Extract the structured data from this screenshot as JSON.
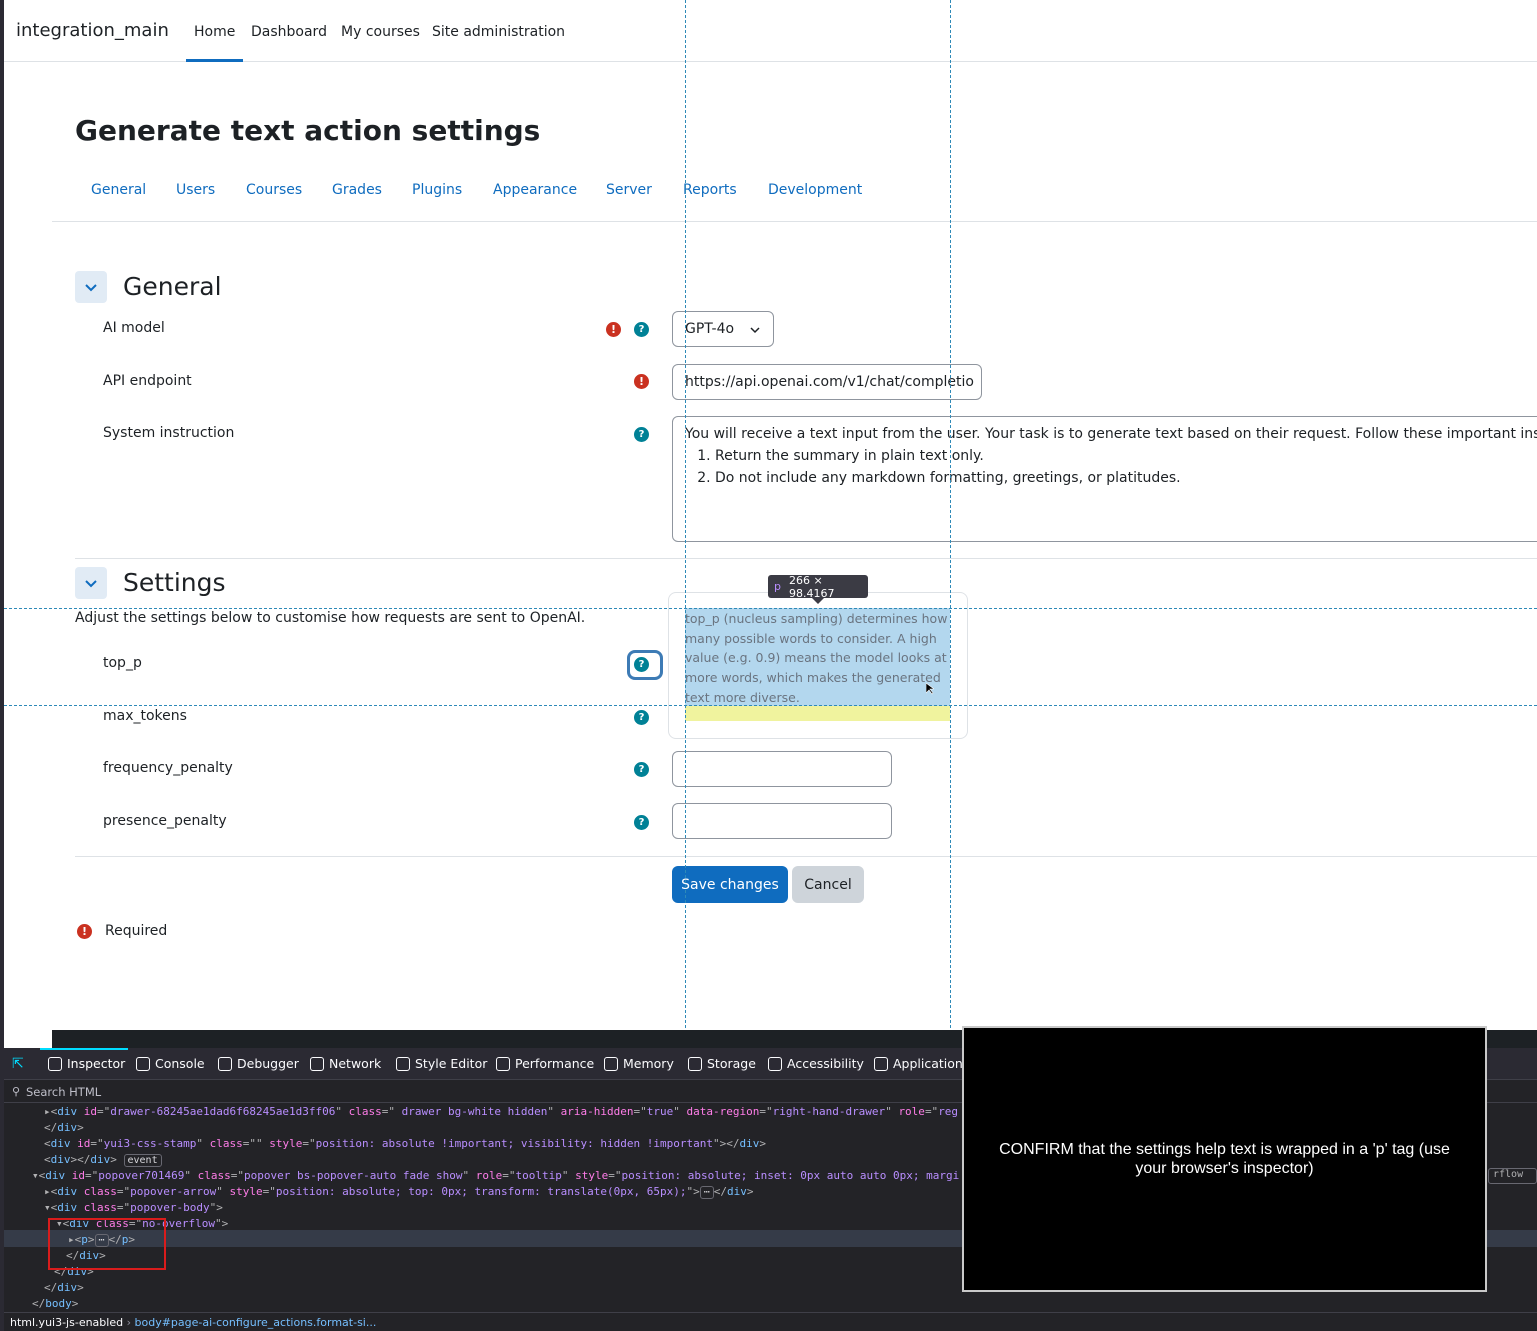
{
  "navbar": {
    "brand": "integration_main",
    "links": [
      "Home",
      "Dashboard",
      "My courses",
      "Site administration"
    ]
  },
  "page": {
    "title": "Generate text action settings",
    "tabs": [
      "General",
      "Users",
      "Courses",
      "Grades",
      "Plugins",
      "Appearance",
      "Server",
      "Reports",
      "Development"
    ]
  },
  "general": {
    "heading": "General",
    "ai_model_label": "AI model",
    "ai_model_value": "GPT-4o",
    "api_endpoint_label": "API endpoint",
    "api_endpoint_value": "https://api.openai.com/v1/chat/completio",
    "system_instruction_label": "System instruction",
    "system_instruction_line1": "You will receive a text input from the user. Your task is to generate text based on their request. Follow these important instruc",
    "system_instruction_item1": "Return the summary in plain text only.",
    "system_instruction_item2": "Do not include any markdown formatting, greetings, or platitudes."
  },
  "settings": {
    "heading": "Settings",
    "description": "Adjust the settings below to customise how requests are sent to OpenAI.",
    "top_p_label": "top_p",
    "max_tokens_label": "max_tokens",
    "frequency_penalty_label": "frequency_penalty",
    "presence_penalty_label": "presence_penalty"
  },
  "popover": {
    "text_lines": [
      "top_p (nucleus sampling) determines how",
      "many possible words to consider. A high",
      "value (e.g. 0.9) means the model looks at",
      "more words, which makes the generated",
      "text more diverse."
    ],
    "dim_tag": "p",
    "dim_size": "266 × 98.4167"
  },
  "buttons": {
    "save": "Save changes",
    "cancel": "Cancel"
  },
  "required_note": "Required",
  "devtools": {
    "tabs": [
      "Inspector",
      "Console",
      "Debugger",
      "Network",
      "Style Editor",
      "Performance",
      "Memory",
      "Storage",
      "Accessibility",
      "Application"
    ],
    "search_placeholder": "Search HTML",
    "lines": [
      {
        "tag": "div",
        "attrs": [
          [
            "id",
            "drawer-68245ae1dad6f68245ae1d3ff06"
          ],
          [
            "class",
            " drawer bg-white hidden"
          ],
          [
            "aria-hidden",
            "true"
          ],
          [
            "data-region",
            "right-hand-drawer"
          ],
          [
            "role",
            "reg"
          ]
        ]
      },
      {
        "text": "</div>"
      },
      {
        "tag": "div",
        "attrs": [
          [
            "id",
            "yui3-css-stamp"
          ],
          [
            "class",
            ""
          ],
          [
            "style",
            "position: absolute !important; visibility: hidden !important"
          ]
        ],
        "close": "</div>"
      },
      {
        "text": "<div></div>",
        "badge": "event"
      },
      {
        "tag": "div",
        "attrs": [
          [
            "id",
            "popover701469"
          ],
          [
            "class",
            "popover bs-popover-auto fade show"
          ],
          [
            "role",
            "tooltip"
          ],
          [
            "style",
            "position: absolute; inset: 0px auto auto 0px; margi"
          ]
        ]
      },
      {
        "tag": "div",
        "attrs": [
          [
            "class",
            "popover-arrow"
          ],
          [
            "style",
            "position: absolute; top: 0px; transform: translate(0px, 65px);"
          ]
        ],
        "close": "</div>"
      },
      {
        "tag": "div",
        "attrs": [
          [
            "class",
            "popover-body"
          ]
        ]
      },
      {
        "tag": "div",
        "attrs": [
          [
            "class",
            "no-overflow"
          ]
        ]
      },
      {
        "text": "<p>⋯</p>"
      },
      {
        "text": "</div>"
      },
      {
        "text": "</div>"
      },
      {
        "text": "</div>"
      },
      {
        "text": "</body>"
      }
    ],
    "overflow_badge": "rflow",
    "breadcrumb_root": "html.yui3-js-enabled",
    "breadcrumb_body": "body#page-ai-configure_actions.format-si..."
  },
  "instruction": "CONFIRM that the settings help text is wrapped in a 'p' tag (use your browser's inspector)"
}
